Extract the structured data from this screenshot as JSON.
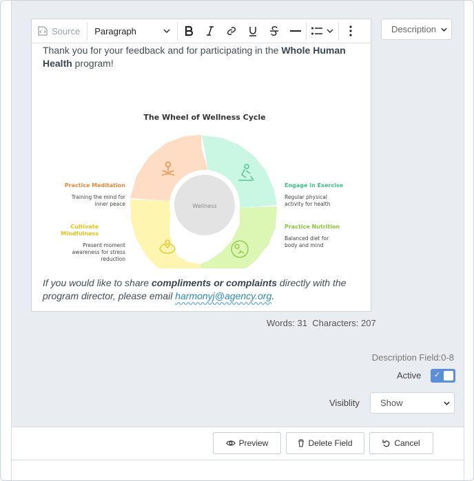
{
  "toolbar": {
    "source_label": "Source",
    "paragraph_label": "Paragraph"
  },
  "content": {
    "intro_prefix": "Thank you for your feedback and for participating in the ",
    "intro_bold": "Whole Human Health",
    "intro_suffix": " program!",
    "outro_prefix": "If you would like to share ",
    "outro_bold": "compliments or complaints",
    "outro_middle": " directly with the program director, please email ",
    "outro_email": "harmonyj@agency.org",
    "outro_suffix": "."
  },
  "wheel": {
    "title": "The Wheel of Wellness Cycle",
    "center_label": "Wellness",
    "segments": [
      {
        "title": "Practice Meditation",
        "desc1": "Training the mind for",
        "desc2": "inner peace",
        "color": "#ffdcc4",
        "accent": "#e8873c"
      },
      {
        "title": "Engage in Exercise",
        "desc1": "Regular physical",
        "desc2": "activity for health",
        "color": "#c9f7e4",
        "accent": "#3dbf84"
      },
      {
        "title": "Practice Nutrition",
        "desc1": "Balanced diet for",
        "desc2": "body and mind",
        "color": "#dcf7b4",
        "accent": "#8cc53d"
      },
      {
        "title1": "Cultivate",
        "title2": "Mindfulness",
        "desc1": "Present moment",
        "desc2": "awareness for stress",
        "desc3": "reduction",
        "color": "#fdf5b0",
        "accent": "#e2c419"
      }
    ]
  },
  "stats": {
    "text": "Words: 31  Characters: 207"
  },
  "side": {
    "description_select": "Description",
    "description_field": "Description Field:0-8",
    "active_label": "Active",
    "visibility_label": "Visiblity",
    "visibility_value": "Show"
  },
  "buttons": {
    "preview": "Preview",
    "delete": "Delete Field",
    "cancel": "Cancel"
  }
}
